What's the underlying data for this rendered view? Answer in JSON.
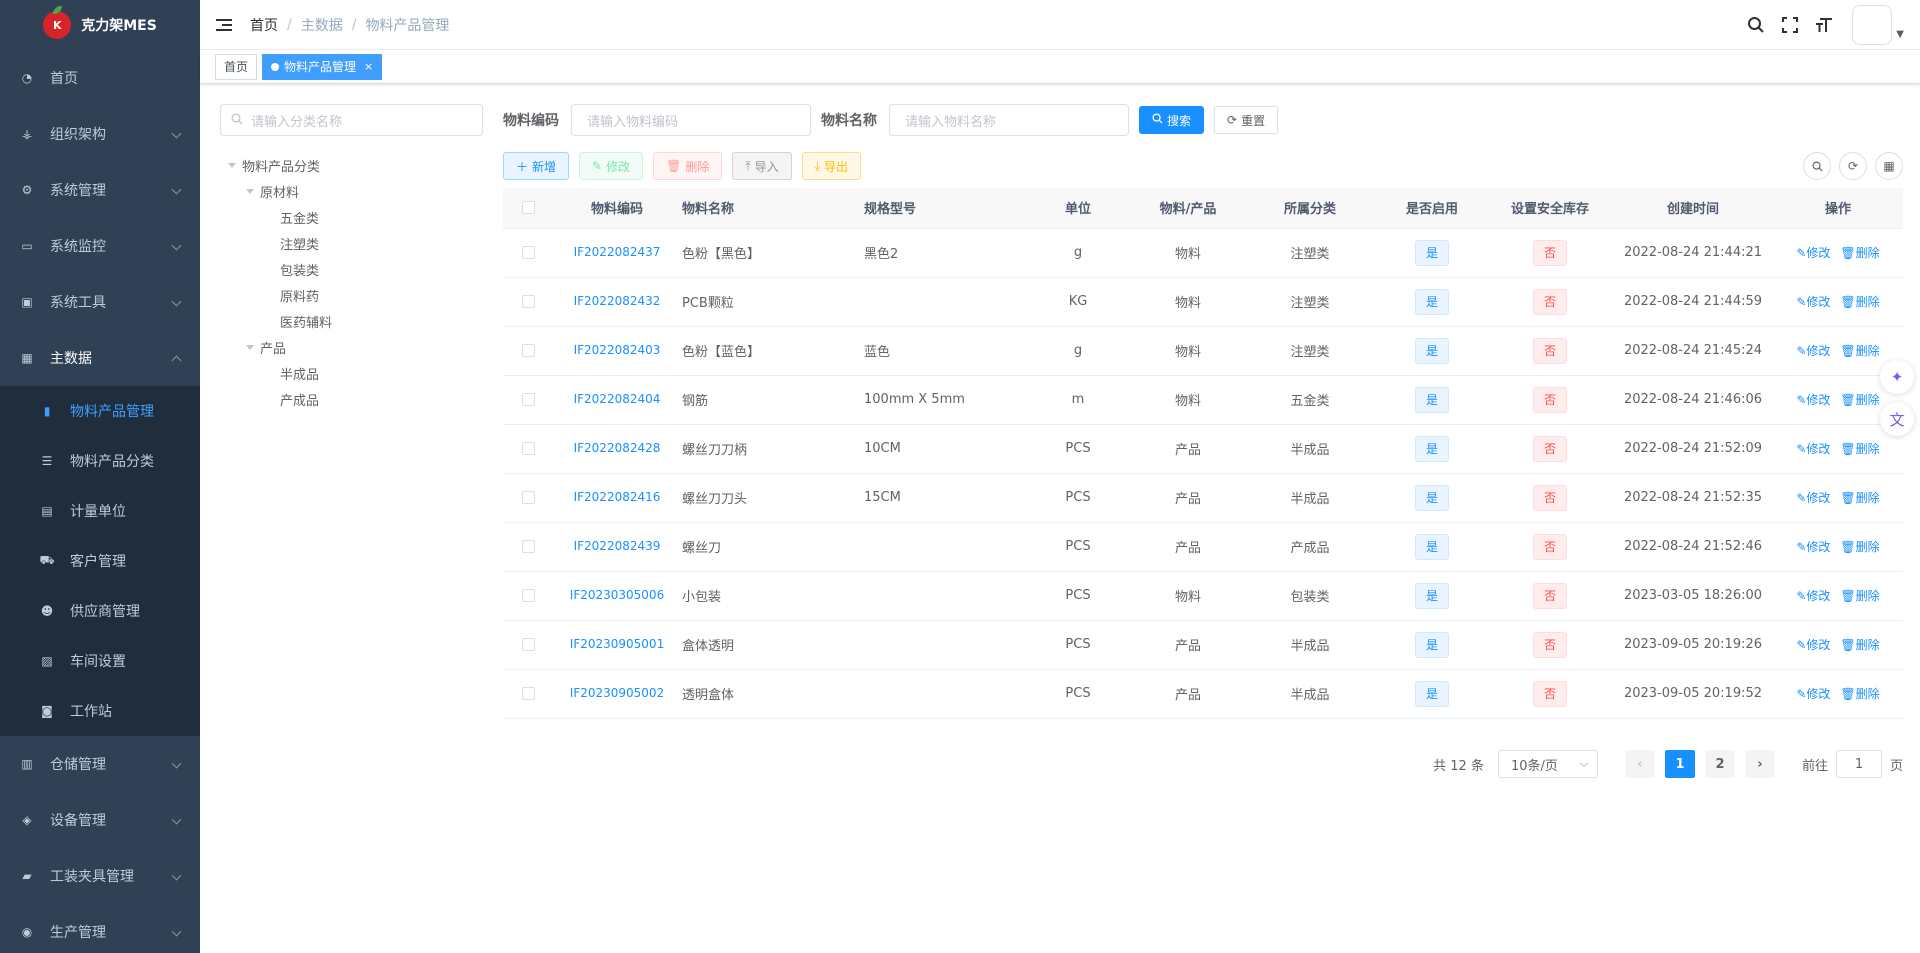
{
  "app": {
    "name": "克力架MES",
    "logo_letter": "K"
  },
  "sidebar": {
    "items": [
      {
        "label": "首页",
        "icon": "dashboard-icon"
      },
      {
        "label": "组织架构",
        "icon": "tree-icon"
      },
      {
        "label": "系统管理",
        "icon": "gear-icon"
      },
      {
        "label": "系统监控",
        "icon": "monitor-icon"
      },
      {
        "label": "系统工具",
        "icon": "toolbox-icon"
      },
      {
        "label": "主数据",
        "icon": "table-icon"
      },
      {
        "label": "仓储管理",
        "icon": "warehouse-icon"
      },
      {
        "label": "设备管理",
        "icon": "layers-icon"
      },
      {
        "label": "工装夹具管理",
        "icon": "lock-icon"
      },
      {
        "label": "生产管理",
        "icon": "eye-icon"
      }
    ],
    "sub_items": [
      {
        "label": "物料产品管理",
        "icon": "book-icon"
      },
      {
        "label": "物料产品分类",
        "icon": "list-icon"
      },
      {
        "label": "计量单位",
        "icon": "file-icon"
      },
      {
        "label": "客户管理",
        "icon": "car-icon"
      },
      {
        "label": "供应商管理",
        "icon": "people-icon"
      },
      {
        "label": "车间设置",
        "icon": "building-icon"
      },
      {
        "label": "工作站",
        "icon": "station-icon"
      }
    ]
  },
  "navbar": {
    "breadcrumb": [
      "首页",
      "主数据",
      "物料产品管理"
    ],
    "sep": "/"
  },
  "tags": {
    "home": "首页",
    "active": "物料产品管理",
    "close": "×"
  },
  "tree": {
    "search_placeholder": "请输入分类名称",
    "root": "物料产品分类",
    "group1": "原材料",
    "group1_children": [
      "五金类",
      "注塑类",
      "包装类",
      "原料药",
      "医药辅料"
    ],
    "group2": "产品",
    "group2_children": [
      "半成品",
      "产成品"
    ]
  },
  "filters": {
    "code_label": "物料编码",
    "code_placeholder": "请输入物料编码",
    "name_label": "物料名称",
    "name_placeholder": "请输入物料名称",
    "search": "搜索",
    "reset": "重置"
  },
  "toolbar": {
    "add": "新增",
    "edit": "修改",
    "delete": "删除",
    "import": "导入",
    "export": "导出"
  },
  "table": {
    "columns": [
      "物料编码",
      "物料名称",
      "规格型号",
      "单位",
      "物料/产品",
      "所属分类",
      "是否启用",
      "设置安全库存",
      "创建时间",
      "操作"
    ],
    "edit_label": "修改",
    "delete_label": "删除",
    "rows": [
      {
        "code": "IF2022082437",
        "name": "色粉【黑色】",
        "spec": "黑色2",
        "unit": "g",
        "type": "物料",
        "category": "注塑类",
        "enabled": "是",
        "safety": "否",
        "created": "2022-08-24 21:44:21"
      },
      {
        "code": "IF2022082432",
        "name": "PCB颗粒",
        "spec": "",
        "unit": "KG",
        "type": "物料",
        "category": "注塑类",
        "enabled": "是",
        "safety": "否",
        "created": "2022-08-24 21:44:59"
      },
      {
        "code": "IF2022082403",
        "name": "色粉【蓝色】",
        "spec": "蓝色",
        "unit": "g",
        "type": "物料",
        "category": "注塑类",
        "enabled": "是",
        "safety": "否",
        "created": "2022-08-24 21:45:24"
      },
      {
        "code": "IF2022082404",
        "name": "钢筋",
        "spec": "100mm X 5mm",
        "unit": "m",
        "type": "物料",
        "category": "五金类",
        "enabled": "是",
        "safety": "否",
        "created": "2022-08-24 21:46:06"
      },
      {
        "code": "IF2022082428",
        "name": "螺丝刀刀柄",
        "spec": "10CM",
        "unit": "PCS",
        "type": "产品",
        "category": "半成品",
        "enabled": "是",
        "safety": "否",
        "created": "2022-08-24 21:52:09"
      },
      {
        "code": "IF2022082416",
        "name": "螺丝刀刀头",
        "spec": "15CM",
        "unit": "PCS",
        "type": "产品",
        "category": "半成品",
        "enabled": "是",
        "safety": "否",
        "created": "2022-08-24 21:52:35"
      },
      {
        "code": "IF2022082439",
        "name": "螺丝刀",
        "spec": "",
        "unit": "PCS",
        "type": "产品",
        "category": "产成品",
        "enabled": "是",
        "safety": "否",
        "created": "2022-08-24 21:52:46"
      },
      {
        "code": "IF20230305006",
        "name": "小包装",
        "spec": "",
        "unit": "PCS",
        "type": "物料",
        "category": "包装类",
        "enabled": "是",
        "safety": "否",
        "created": "2023-03-05 18:26:00"
      },
      {
        "code": "IF20230905001",
        "name": "盒体透明",
        "spec": "",
        "unit": "PCS",
        "type": "产品",
        "category": "半成品",
        "enabled": "是",
        "safety": "否",
        "created": "2023-09-05 20:19:26"
      },
      {
        "code": "IF20230905002",
        "name": "透明盒体",
        "spec": "",
        "unit": "PCS",
        "type": "产品",
        "category": "半成品",
        "enabled": "是",
        "safety": "否",
        "created": "2023-09-05 20:19:52"
      }
    ]
  },
  "pagination": {
    "total": "共 12 条",
    "page_size": "10条/页",
    "pages": [
      "1",
      "2"
    ],
    "prev": "‹",
    "next": "›",
    "goto_prefix": "前往",
    "goto_value": "1",
    "goto_suffix": "页"
  },
  "colors": {
    "sidebar_bg": "#304156",
    "submenu_bg": "#1f2d3d",
    "primary": "#1890ff",
    "active_menu": "#409eff"
  }
}
